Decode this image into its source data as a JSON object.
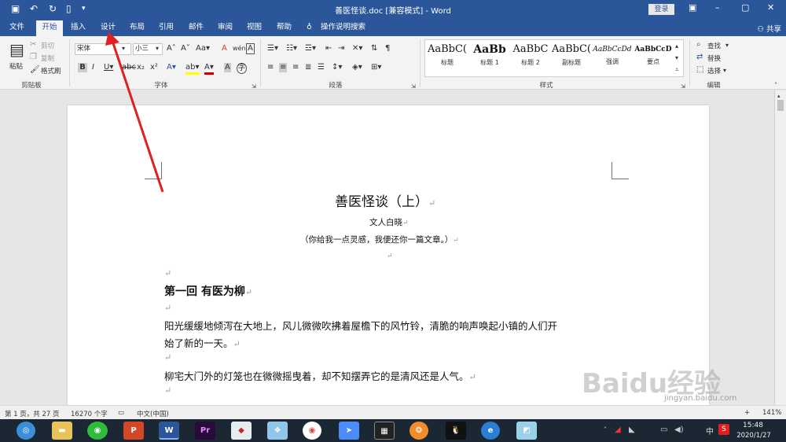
{
  "window": {
    "title": "善医怪谈.doc [兼容模式] - Word",
    "login": "登录"
  },
  "tabs": [
    "文件",
    "开始",
    "插入",
    "设计",
    "布局",
    "引用",
    "邮件",
    "审阅",
    "视图",
    "帮助",
    "操作说明搜索"
  ],
  "share": "共享",
  "clipboard": {
    "paste": "粘贴",
    "cut": "剪切",
    "copy": "复制",
    "format_painter": "格式刷",
    "label": "剪贴板"
  },
  "font": {
    "name": "宋体",
    "size": "小三",
    "label": "字体"
  },
  "paragraph": {
    "label": "段落"
  },
  "styles": {
    "label": "样式",
    "items": [
      {
        "sample": "AaBbC(",
        "name": "标题"
      },
      {
        "sample": "AaBb",
        "name": "标题 1"
      },
      {
        "sample": "AaBbC",
        "name": "标题 2"
      },
      {
        "sample": "AaBbC(",
        "name": "副标题"
      },
      {
        "sample": "AaBbCcDd",
        "name": "强调"
      },
      {
        "sample": "AaBbCcD",
        "name": "要点"
      }
    ]
  },
  "editing": {
    "find": "查找",
    "replace": "替换",
    "select": "选择",
    "label": "编辑"
  },
  "doc": {
    "title": "善医怪谈（上）",
    "author": "文人白晓",
    "subtitle": "（你给我一点灵感，我便还你一篇文章。）",
    "chapter": "第一回 有医为柳",
    "p1a": "阳光缓缓地倾泻在大地上，风儿微微吹拂着屋檐下的风竹铃，清脆的响声唤起小镇的人们开",
    "p1b": "始了新的一天。",
    "p2": "柳宅大门外的灯笼也在微微摇曳着，却不知摆弄它的是清风还是人气。"
  },
  "status": {
    "page": "第 1 页，共 27 页",
    "words": "16270 个字",
    "lang": "中文(中国)",
    "zoom": "141%"
  },
  "taskbar": {
    "time": "15:48",
    "date": "2020/1/27"
  },
  "watermark": "Baidu经验",
  "watermark_url": "jingyan.baidu.com"
}
